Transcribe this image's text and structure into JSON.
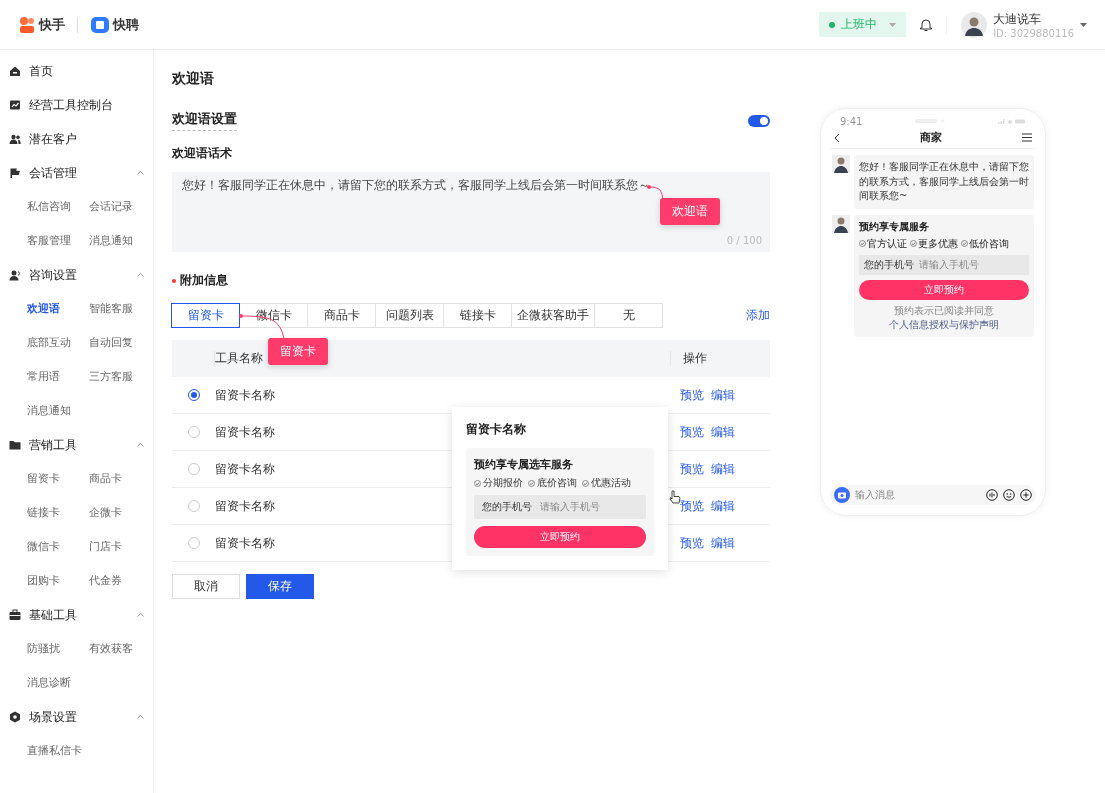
{
  "header": {
    "logos": [
      "快手",
      "快聘"
    ],
    "status": {
      "label": "上班中"
    },
    "user": {
      "name": "大迪说车",
      "id": "ID: 3029880116"
    }
  },
  "sidebar": {
    "items": [
      {
        "label": "首页",
        "selected": false
      },
      {
        "label": "经营工具控制台",
        "selected": false
      },
      {
        "label": "潜在客户",
        "selected": false
      },
      {
        "label": "会话管理",
        "expanded": true,
        "children": [
          {
            "label": "私信咨询",
            "selected": false
          },
          {
            "label": "会话记录",
            "selected": false
          },
          {
            "label": "客服管理",
            "selected": false
          },
          {
            "label": "消息通知",
            "selected": false
          }
        ]
      },
      {
        "label": "咨询设置",
        "expanded": true,
        "children": [
          {
            "label": "欢迎语",
            "selected": true
          },
          {
            "label": "智能客服",
            "selected": false
          },
          {
            "label": "底部互动",
            "selected": false
          },
          {
            "label": "自动回复",
            "selected": false
          },
          {
            "label": "常用语",
            "selected": false
          },
          {
            "label": "三方客服",
            "selected": false
          },
          {
            "label": "消息通知",
            "selected": false
          }
        ]
      },
      {
        "label": "营销工具",
        "expanded": true,
        "children": [
          {
            "label": "留资卡",
            "selected": false
          },
          {
            "label": "商品卡",
            "selected": false
          },
          {
            "label": "链接卡",
            "selected": false
          },
          {
            "label": "企微卡",
            "selected": false
          },
          {
            "label": "微信卡",
            "selected": false
          },
          {
            "label": "门店卡",
            "selected": false
          },
          {
            "label": "团购卡",
            "selected": false
          },
          {
            "label": "代金券",
            "selected": false
          }
        ]
      },
      {
        "label": "基础工具",
        "expanded": true,
        "children": [
          {
            "label": "防骚扰",
            "selected": false
          },
          {
            "label": "有效获客",
            "selected": false
          },
          {
            "label": "消息诊断",
            "selected": false
          }
        ]
      },
      {
        "label": "场景设置",
        "expanded": true,
        "children": [
          {
            "label": "直播私信卡",
            "selected": false
          }
        ]
      }
    ]
  },
  "page": {
    "title": "欢迎语",
    "setting_label": "欢迎语设置",
    "enabled": true,
    "script_label": "欢迎语话术",
    "script_text": "您好！客服同学正在休息中，请留下您的联系方式，客服同学上线后会第一时间联系您～",
    "counter": "0 / 100",
    "extra_label": "附加信息",
    "tabs": [
      {
        "label": "留资卡",
        "selected": true
      },
      {
        "label": "微信卡",
        "selected": false
      },
      {
        "label": "商品卡",
        "selected": false
      },
      {
        "label": "问题列表",
        "selected": false
      },
      {
        "label": "链接卡",
        "selected": false
      },
      {
        "label": "企微获客助手",
        "selected": false
      },
      {
        "label": "无",
        "selected": false
      }
    ],
    "add_link": "添加",
    "table": {
      "columns": [
        "工具名称",
        "操作"
      ],
      "rows": [
        {
          "name": "留资卡名称",
          "selected": true,
          "actions": [
            "预览",
            "编辑"
          ]
        },
        {
          "name": "留资卡名称",
          "selected": false,
          "actions": [
            "预览",
            "编辑"
          ]
        },
        {
          "name": "留资卡名称",
          "selected": false,
          "actions": [
            "预览",
            "编辑"
          ]
        },
        {
          "name": "留资卡名称",
          "selected": false,
          "actions": [
            "预览",
            "编辑"
          ]
        },
        {
          "name": "留资卡名称",
          "selected": false,
          "actions": [
            "预览",
            "编辑"
          ]
        }
      ]
    },
    "buttons": [
      {
        "label": "取消",
        "kind": "default"
      },
      {
        "label": "保存",
        "kind": "primary"
      }
    ],
    "annotations": [
      "欢迎语",
      "留资卡"
    ],
    "popover": {
      "title": "留资卡名称",
      "card": {
        "title": "预约享专属选车服务",
        "tags": [
          "分期报价",
          "底价咨询",
          "优惠活动"
        ],
        "phone_label": "您的手机号",
        "phone_placeholder": "请输入手机号",
        "button": "立即预约"
      }
    }
  },
  "phone": {
    "time": "9:41",
    "title": "商家",
    "message": "您好！客服同学正在休息中，请留下您的联系方式，客服同学上线后会第一时间联系您~",
    "card": {
      "title": "预约享专属服务",
      "tags": [
        "官方认证",
        "更多优惠",
        "低价咨询"
      ],
      "phone_label": "您的手机号",
      "phone_placeholder": "请输入手机号",
      "button": "立即预约",
      "note": "预约表示已阅读并同意",
      "note_link": "个人信息授权与保护声明"
    },
    "input_placeholder": "输入消息"
  }
}
